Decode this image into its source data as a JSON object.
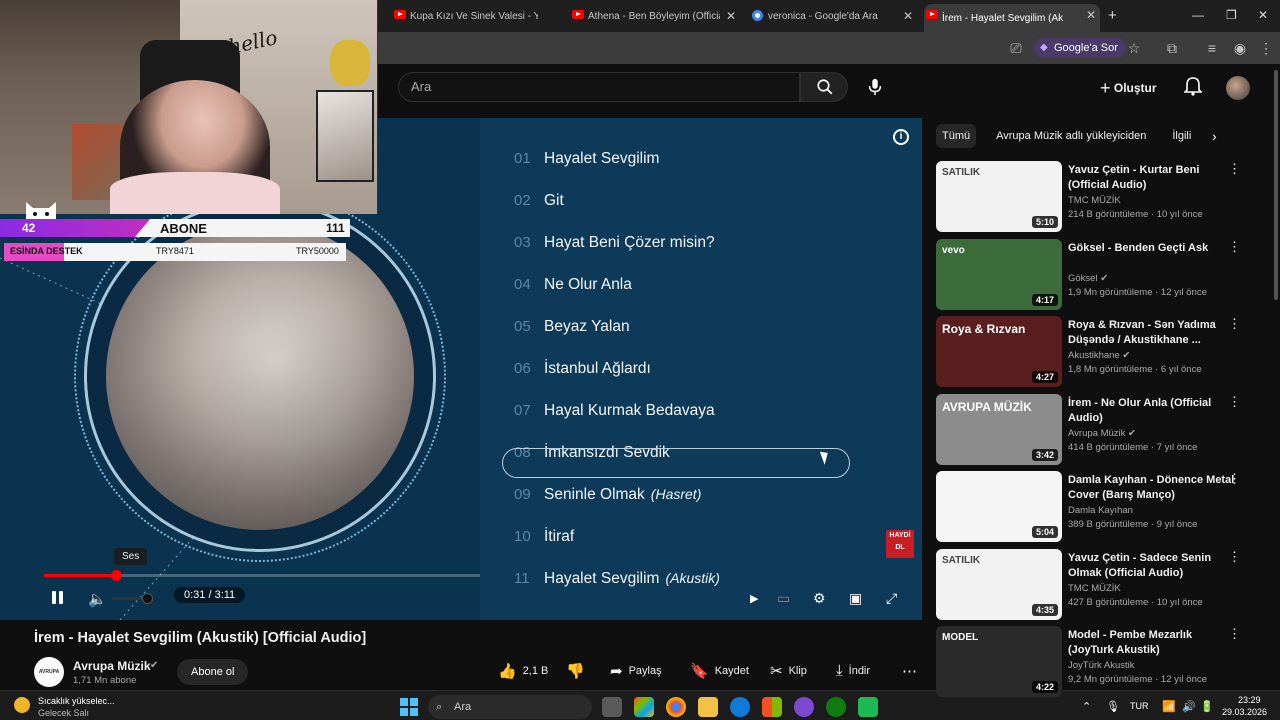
{
  "browser": {
    "tabs": [
      {
        "title": "Kupa Kızı Ve Sinek Valesi - YouT",
        "icon": "youtube-icon"
      },
      {
        "title": "Athena - Ben Böyleyim (Official",
        "icon": "youtube-icon"
      },
      {
        "title": "veronica - Google'da Ara",
        "icon": "google-icon"
      },
      {
        "title": "İrem - Hayalet Sevgilim (Ak",
        "icon": "youtube-icon"
      }
    ],
    "new_tab": "+",
    "google_sor": "Google'a Sor"
  },
  "youtube": {
    "search_placeholder": "Ara",
    "create_label": "Oluştur",
    "video_title": "İrem - Hayalet Sevgilim (Akustik) [Official Audio]",
    "channel": {
      "name": "Avrupa Müzik",
      "subscribers": "1,71 Mn abone",
      "avatar_text": "AVRUPA MÜZİK"
    },
    "subscribe_label": "Abone ol",
    "actions": {
      "likes": "2,1 B",
      "share": "Paylaş",
      "save": "Kaydet",
      "clip": "Klip",
      "download": "İndir"
    }
  },
  "player": {
    "tracklist": [
      {
        "num": "01",
        "title": "Hayalet Sevgilim",
        "note": ""
      },
      {
        "num": "02",
        "title": "Git",
        "note": ""
      },
      {
        "num": "03",
        "title": "Hayat Beni Çözer misin?",
        "note": ""
      },
      {
        "num": "04",
        "title": "Ne Olur Anla",
        "note": ""
      },
      {
        "num": "05",
        "title": "Beyaz Yalan",
        "note": ""
      },
      {
        "num": "06",
        "title": "İstanbul Ağlardı",
        "note": ""
      },
      {
        "num": "07",
        "title": "Hayal Kurmak Bedavaya",
        "note": ""
      },
      {
        "num": "08",
        "title": "İmkansızdı Sevdik",
        "note": ""
      },
      {
        "num": "09",
        "title": "Seninle Olmak",
        "note": "(Hasret)"
      },
      {
        "num": "10",
        "title": "İtiraf",
        "note": ""
      },
      {
        "num": "11",
        "title": "Hayalet Sevgilim",
        "note": "(Akustik)"
      }
    ],
    "current_time": "0:31 / 3:11",
    "progress_fraction": 0.166,
    "volume_tooltip": "Ses",
    "download_badge": "HAYDİ DL",
    "colors": {
      "progress": "#ff0000",
      "panel": "#0c3a58"
    }
  },
  "stream_overlay": {
    "count": "42",
    "abone_label": "ABONE",
    "abone_value": "111",
    "destek_label": "ESİNDA DESTEK",
    "try_current": "TRY8471",
    "try_goal": "TRY50000",
    "cam_text": "hello"
  },
  "sidebar": {
    "chips": [
      "Tümü",
      "Avrupa Müzik adlı yükleyiciden",
      "İlgili"
    ],
    "recommendations": [
      {
        "title": "Yavuz Çetin - Kurtar Beni (Official Audio)",
        "channel": "TMC MÜZİK",
        "meta": "214 B görüntüleme · 10 yıl önce",
        "duration": "5:10",
        "verified": false,
        "thumb_color": "#f2f2f2",
        "thumb_text": "SATILIK"
      },
      {
        "title": "Göksel - Benden Geçti Ask",
        "channel": "Göksel",
        "meta": "1,9 Mn görüntüleme · 12 yıl önce",
        "duration": "4:17",
        "verified": true,
        "thumb_color": "#3b6b3a",
        "thumb_text": "vevo"
      },
      {
        "title": "Roya & Rızvan - Sən Yadıma Düşəndə / Akustikhane ...",
        "channel": "Akustikhane",
        "meta": "1,8 Mn görüntüleme · 6 yıl önce",
        "duration": "4:27",
        "verified": true,
        "thumb_color": "#5a1e1e",
        "thumb_text": "Roya & Rızvan"
      },
      {
        "title": "İrem - Ne Olur Anla (Official Audio)",
        "channel": "Avrupa Müzik",
        "meta": "414 B görüntüleme · 7 yıl önce",
        "duration": "3:42",
        "verified": true,
        "thumb_color": "#8c8c8c",
        "thumb_text": "AVRUPA MÜZİK"
      },
      {
        "title": "Damla Kayıhan - Dönence Metal Cover (Barış Manço)",
        "channel": "Damla Kayıhan",
        "meta": "389 B görüntüleme · 9 yıl önce",
        "duration": "5:04",
        "verified": false,
        "thumb_color": "#f5f5f5",
        "thumb_text": ""
      },
      {
        "title": "Yavuz Çetin - Sadece Senin Olmak (Official Audio)",
        "channel": "TMC MÜZİK",
        "meta": "427 B görüntüleme · 10 yıl önce",
        "duration": "4:35",
        "verified": false,
        "thumb_color": "#f2f2f2",
        "thumb_text": "SATILIK"
      },
      {
        "title": "Model - Pembe Mezarlık (JoyTurk Akustik)",
        "channel": "JoyTürk Akustik",
        "meta": "9,2 Mn görüntüleme · 12 yıl önce",
        "duration": "4:22",
        "verified": false,
        "thumb_color": "#2a2a2a",
        "thumb_text": "MODEL"
      }
    ]
  },
  "taskbar": {
    "weather_line1": "Sıcaklık yükselec...",
    "weather_line2": "Gelecek Salı",
    "search_placeholder": "Ara",
    "language": "TUR",
    "time": "23:29",
    "date": "29.03.2026"
  }
}
